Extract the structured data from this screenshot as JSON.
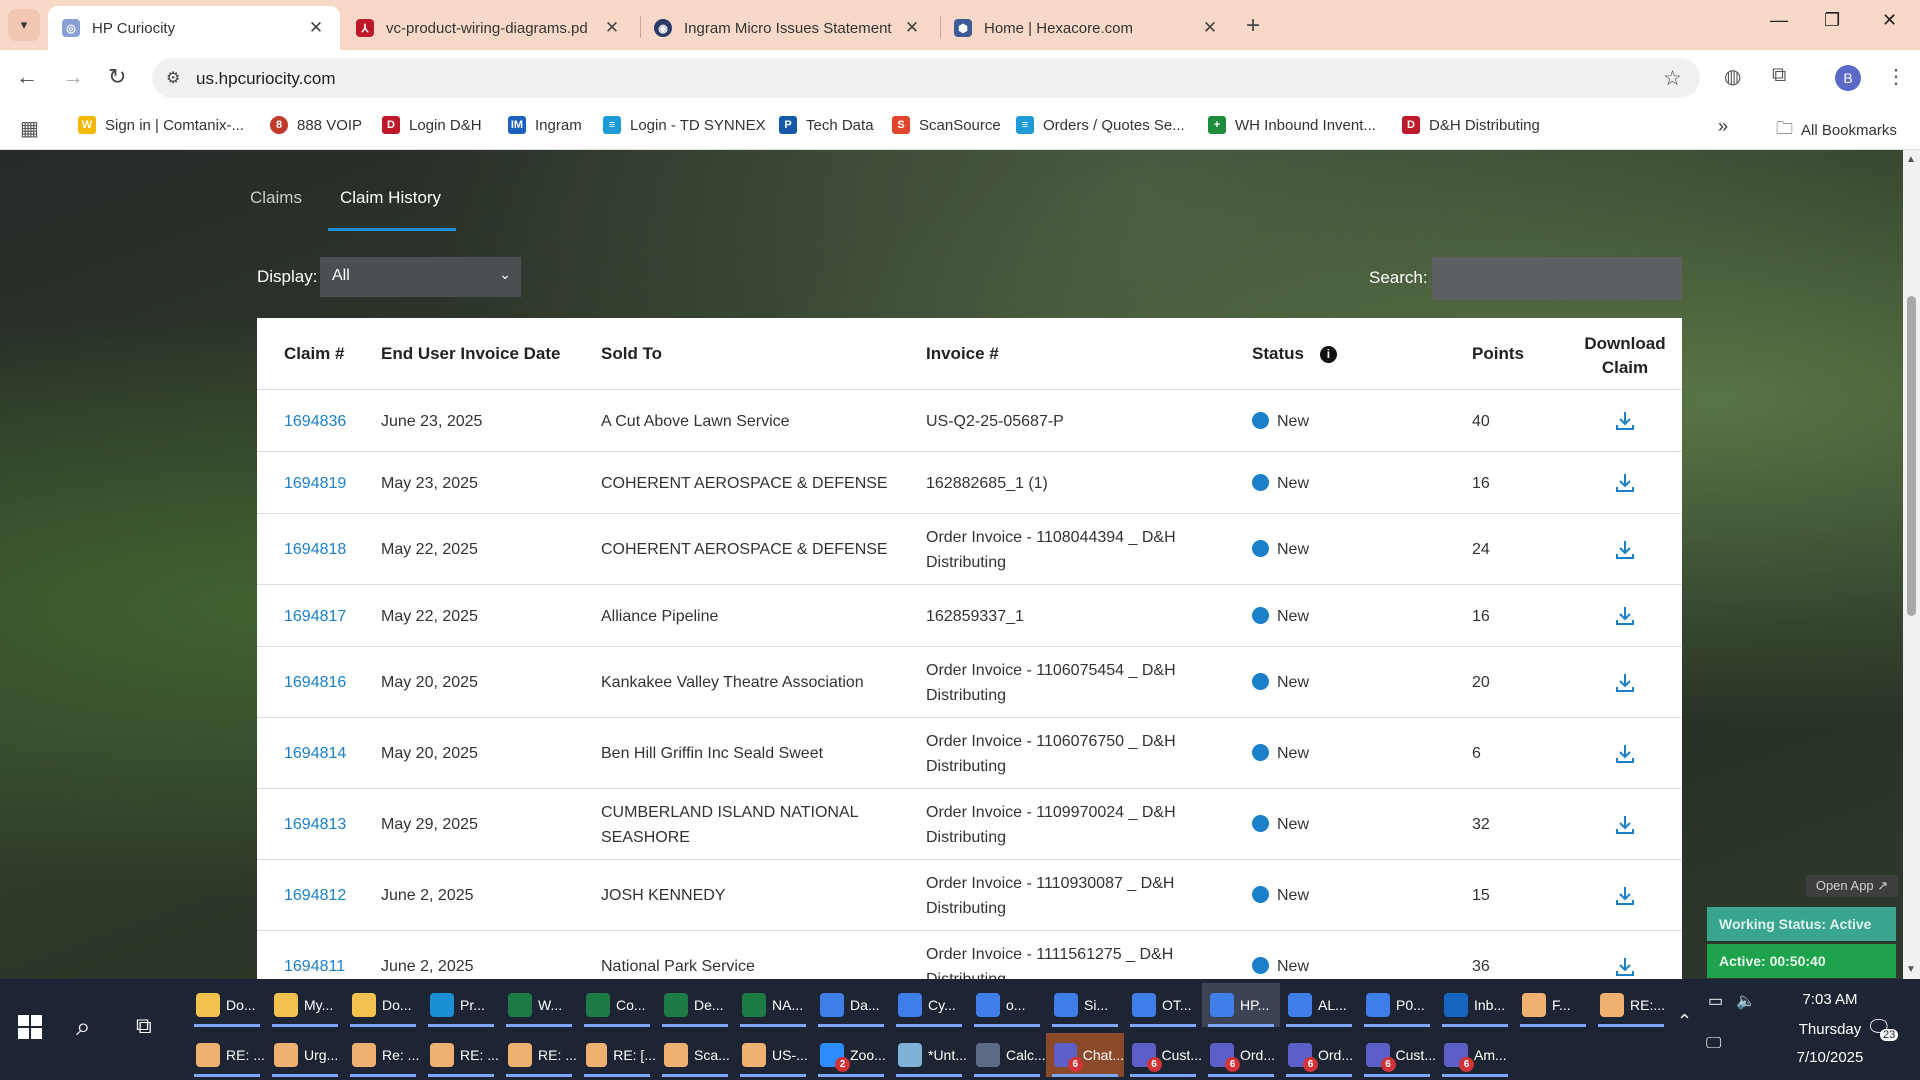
{
  "browser": {
    "tabs": [
      {
        "title": "HP Curiocity",
        "icon": "hp-curiocity-favicon",
        "active": true
      },
      {
        "title": "vc-product-wiring-diagrams.pd",
        "icon": "pdf-icon",
        "active": false
      },
      {
        "title": "Ingram Micro Issues Statement",
        "icon": "ingram-micro-favicon",
        "active": false
      },
      {
        "title": "Home | Hexacore.com",
        "icon": "hexacore-favicon",
        "active": false
      }
    ],
    "url": "us.hpcuriocity.com",
    "profile_initial": "B",
    "bookmarks": [
      {
        "label": "Sign in | Comtanix-...",
        "icon": "comtanix-icon",
        "color": "#f5b800"
      },
      {
        "label": "888 VOIP",
        "icon": "voip-icon",
        "color": "#c0392b"
      },
      {
        "label": "Login D&H",
        "icon": "dh-icon",
        "color": "#c0182b"
      },
      {
        "label": "Ingram",
        "icon": "ingram-icon",
        "color": "#1d5fbf"
      },
      {
        "label": "Login - TD SYNNEX",
        "icon": "td-synnex-icon",
        "color": "#1e9bd7"
      },
      {
        "label": "Tech Data",
        "icon": "tech-data-icon",
        "color": "#1659a8"
      },
      {
        "label": "ScanSource",
        "icon": "scansource-icon",
        "color": "#e0462b"
      },
      {
        "label": "Orders / Quotes Se...",
        "icon": "orders-icon",
        "color": "#1e9bd7"
      },
      {
        "label": "WH Inbound Invent...",
        "icon": "sheets-icon",
        "color": "#1e8e3e"
      },
      {
        "label": "D&H Distributing",
        "icon": "dh-icon",
        "color": "#c0182b"
      }
    ],
    "all_bookmarks_label": "All Bookmarks"
  },
  "page": {
    "tabs": [
      {
        "label": "Claims",
        "active": false
      },
      {
        "label": "Claim History",
        "active": true
      }
    ],
    "display_label": "Display:",
    "display_value": "All",
    "search_label": "Search:",
    "search_value": "",
    "accent": "#1a80c9",
    "table": {
      "headers": {
        "claim": "Claim #",
        "date": "End User Invoice Date",
        "sold_to": "Sold To",
        "invoice": "Invoice #",
        "status": "Status",
        "points": "Points",
        "download_1": "Download",
        "download_2": "Claim"
      },
      "rows": [
        {
          "claim": "1694836",
          "date": "June 23, 2025",
          "sold_to": [
            "A Cut Above Lawn Service"
          ],
          "invoice": [
            "US-Q2-25-05687-P"
          ],
          "status": "New",
          "points": "40"
        },
        {
          "claim": "1694819",
          "date": "May 23, 2025",
          "sold_to": [
            "COHERENT AEROSPACE & DEFENSE"
          ],
          "invoice": [
            "162882685_1 (1)"
          ],
          "status": "New",
          "points": "16"
        },
        {
          "claim": "1694818",
          "date": "May 22, 2025",
          "sold_to": [
            "COHERENT AEROSPACE & DEFENSE"
          ],
          "invoice": [
            "Order Invoice - 1108044394 _ D&H",
            "Distributing"
          ],
          "status": "New",
          "points": "24"
        },
        {
          "claim": "1694817",
          "date": "May 22, 2025",
          "sold_to": [
            "Alliance Pipeline"
          ],
          "invoice": [
            "162859337_1"
          ],
          "status": "New",
          "points": "16"
        },
        {
          "claim": "1694816",
          "date": "May 20, 2025",
          "sold_to": [
            "Kankakee Valley Theatre Association"
          ],
          "invoice": [
            "Order Invoice - 1106075454 _ D&H",
            "Distributing"
          ],
          "status": "New",
          "points": "20"
        },
        {
          "claim": "1694814",
          "date": "May 20, 2025",
          "sold_to": [
            "Ben Hill Griffin Inc Seald Sweet"
          ],
          "invoice": [
            "Order Invoice - 1106076750 _ D&H",
            "Distributing"
          ],
          "status": "New",
          "points": "6"
        },
        {
          "claim": "1694813",
          "date": "May 29, 2025",
          "sold_to": [
            "CUMBERLAND ISLAND NATIONAL",
            "SEASHORE"
          ],
          "invoice": [
            "Order Invoice - 1109970024 _ D&H",
            "Distributing"
          ],
          "status": "New",
          "points": "32"
        },
        {
          "claim": "1694812",
          "date": "June 2, 2025",
          "sold_to": [
            "JOSH KENNEDY"
          ],
          "invoice": [
            "Order Invoice - 1110930087 _ D&H",
            "Distributing"
          ],
          "status": "New",
          "points": "15"
        },
        {
          "claim": "1694811",
          "date": "June 2, 2025",
          "sold_to": [
            "National Park Service"
          ],
          "invoice": [
            "Order Invoice - 1111561275 _ D&H",
            "Distributing"
          ],
          "status": "New",
          "points": "36"
        }
      ]
    }
  },
  "widget": {
    "open_app": "Open App ↗",
    "working_status": "Working Status: Active",
    "active_timer": "Active: 00:50:40"
  },
  "taskbar": {
    "row1": [
      {
        "label": "Do...",
        "icon": "folder-icon",
        "color": "#f2c14e"
      },
      {
        "label": "My...",
        "icon": "folder-icon",
        "color": "#f2c14e"
      },
      {
        "label": "Do...",
        "icon": "folder-icon",
        "color": "#f2c14e"
      },
      {
        "label": "Pr...",
        "icon": "edge-icon",
        "color": "#1b8fd6"
      },
      {
        "label": "W...",
        "icon": "excel-icon",
        "color": "#1e7a45"
      },
      {
        "label": "Co...",
        "icon": "excel-icon",
        "color": "#1e7a45"
      },
      {
        "label": "De...",
        "icon": "excel-icon",
        "color": "#1e7a45"
      },
      {
        "label": "NA...",
        "icon": "excel-icon",
        "color": "#1e7a45"
      },
      {
        "label": "Da...",
        "icon": "chrome-icon",
        "color": "#3f7ee8"
      },
      {
        "label": "Cy...",
        "icon": "chrome-icon",
        "color": "#3f7ee8"
      },
      {
        "label": "o...",
        "icon": "chrome-icon",
        "color": "#3f7ee8"
      },
      {
        "label": "Si...",
        "icon": "chrome-icon",
        "color": "#3f7ee8"
      },
      {
        "label": "OT...",
        "icon": "chrome-icon",
        "color": "#3f7ee8"
      },
      {
        "label": "HP...",
        "icon": "chrome-icon",
        "color": "#3f7ee8"
      },
      {
        "label": "AL...",
        "icon": "chrome-icon",
        "color": "#3f7ee8"
      },
      {
        "label": "P0...",
        "icon": "chrome-icon",
        "color": "#3f7ee8"
      },
      {
        "label": "Inb...",
        "icon": "outlook-icon",
        "color": "#1565c0"
      },
      {
        "label": "F...",
        "icon": "mail-icon",
        "color": "#f0b070"
      },
      {
        "label": "RE:...",
        "icon": "mail-icon",
        "color": "#f0b070"
      }
    ],
    "row2": [
      {
        "label": "RE: ...",
        "icon": "mail-icon",
        "color": "#f0b070"
      },
      {
        "label": "Urg...",
        "icon": "mail-icon",
        "color": "#f0b070"
      },
      {
        "label": "Re: ...",
        "icon": "mail-icon",
        "color": "#f0b070"
      },
      {
        "label": "RE: ...",
        "icon": "mail-icon",
        "color": "#f0b070"
      },
      {
        "label": "RE: ...",
        "icon": "mail-icon",
        "color": "#f0b070"
      },
      {
        "label": "RE: [...",
        "icon": "mail-icon",
        "color": "#f0b070"
      },
      {
        "label": "Sca...",
        "icon": "mail-icon",
        "color": "#f0b070"
      },
      {
        "label": "US-...",
        "icon": "mail-icon",
        "color": "#f0b070"
      },
      {
        "label": "Zoo...",
        "icon": "zoom-icon",
        "color": "#2d8cff",
        "badge": "2"
      },
      {
        "label": "*Unt...",
        "icon": "notepad-icon",
        "color": "#7fb3d5"
      },
      {
        "label": "Calc...",
        "icon": "calculator-icon",
        "color": "#5a6a82"
      },
      {
        "label": "Chat...",
        "icon": "teams-icon",
        "color": "#5b5fc7",
        "badge": "6"
      },
      {
        "label": "Cust...",
        "icon": "teams-icon",
        "color": "#5b5fc7",
        "badge": "6"
      },
      {
        "label": "Ord...",
        "icon": "teams-icon",
        "color": "#5b5fc7",
        "badge": "6"
      },
      {
        "label": "Ord...",
        "icon": "teams-icon",
        "color": "#5b5fc7",
        "badge": "6"
      },
      {
        "label": "Cust...",
        "icon": "teams-icon",
        "color": "#5b5fc7",
        "badge": "6"
      },
      {
        "label": "Am...",
        "icon": "teams-icon",
        "color": "#5b5fc7",
        "badge": "6"
      }
    ],
    "time": "7:03 AM",
    "day": "Thursday",
    "date": "7/10/2025",
    "notifications": "23"
  }
}
